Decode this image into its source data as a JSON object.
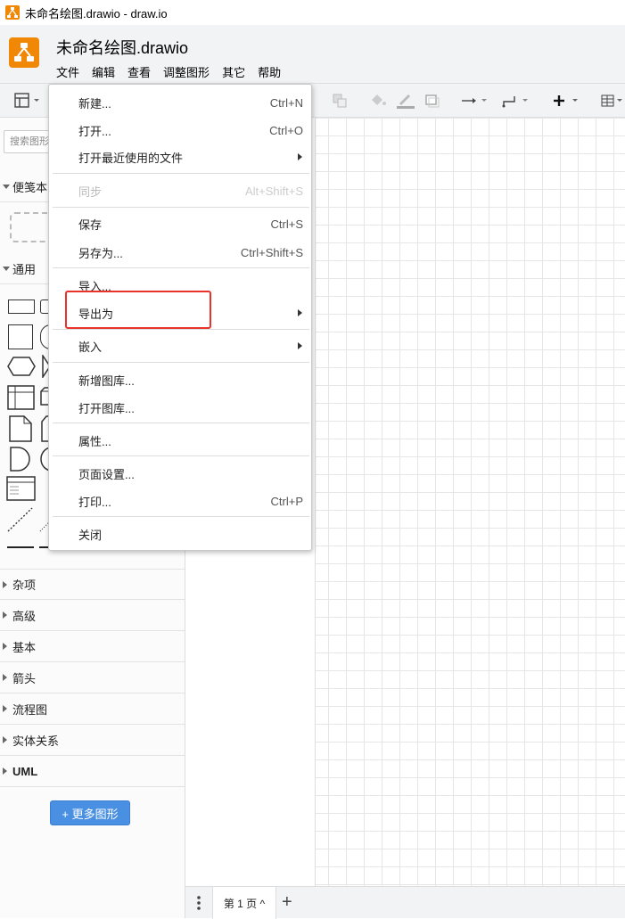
{
  "window": {
    "title": "未命名绘图.drawio - draw.io"
  },
  "header": {
    "doc_title": "未命名绘图.drawio",
    "menu": [
      "文件",
      "编辑",
      "查看",
      "调整图形",
      "其它",
      "帮助"
    ]
  },
  "sidebar": {
    "search_placeholder": "搜索图形",
    "sections_top": [
      "便笺本",
      "通用"
    ],
    "sections_bottom": [
      "杂项",
      "高级",
      "基本",
      "箭头",
      "流程图",
      "实体关系",
      "UML"
    ],
    "more_shapes": "+ 更多图形"
  },
  "file_menu": {
    "items": [
      {
        "label": "新建...",
        "shortcut": "Ctrl+N"
      },
      {
        "label": "打开...",
        "shortcut": "Ctrl+O"
      },
      {
        "label": "打开最近使用的文件",
        "submenu": true
      },
      {
        "label": "同步",
        "shortcut": "Alt+Shift+S",
        "disabled": true
      },
      {
        "label": "保存",
        "shortcut": "Ctrl+S"
      },
      {
        "label": "另存为...",
        "shortcut": "Ctrl+Shift+S"
      },
      {
        "label": "导入..."
      },
      {
        "label": "导出为",
        "submenu": true,
        "highlighted": true
      },
      {
        "label": "嵌入",
        "submenu": true
      },
      {
        "label": "新增图库..."
      },
      {
        "label": "打开图库..."
      },
      {
        "label": "属性..."
      },
      {
        "label": "页面设置..."
      },
      {
        "label": "打印...",
        "shortcut": "Ctrl+P"
      },
      {
        "label": "关闭"
      }
    ]
  },
  "bottom": {
    "page_tab": "第 1 页 ^",
    "add_page": "+"
  },
  "colors": {
    "accent": "#f08705",
    "button_blue": "#4a90e2",
    "highlight_red": "#e8322b"
  },
  "icons": [
    "format-panel-icon",
    "fill-color-icon",
    "line-color-icon",
    "shadow-icon",
    "connection-arrow-icon",
    "waypoint-icon",
    "insert-plus-icon",
    "table-icon",
    "page-menu-icon"
  ]
}
